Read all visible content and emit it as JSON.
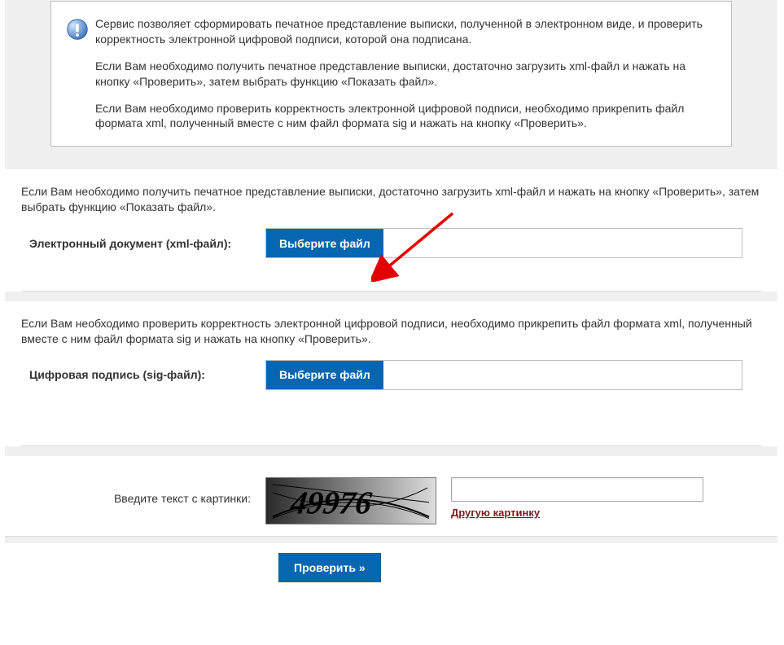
{
  "info": {
    "p1": "Сервис позволяет сформировать печатное представление выписки, полученной в электронном виде, и проверить корректность электронной цифровой подписи, которой она подписана.",
    "p2": "Если Вам необходимо получить печатное представление выписки, достаточно загрузить xml-файл и нажать на кнопку «Проверить», затем выбрать функцию «Показать файл».",
    "p3": "Если Вам необходимо проверить корректность электронной цифровой подписи, необходимо прикрепить файл формата xml, полученный вместе с ним файл формата sig и нажать на кнопку «Проверить»."
  },
  "xml_section": {
    "desc": "Если Вам необходимо получить печатное представление выписки, достаточно загрузить xml-файл и нажать на кнопку «Проверить», затем выбрать функцию «Показать файл».",
    "label": "Электронный документ (xml-файл):",
    "button": "Выберите файл",
    "value": ""
  },
  "sig_section": {
    "desc": "Если Вам необходимо проверить корректность электронной цифровой подписи, необходимо прикрепить файл формата xml, полученный вместе с ним файл формата sig и нажать на кнопку «Проверить».",
    "label": "Цифровая подпись (sig-файл):",
    "button": "Выберите файл",
    "value": ""
  },
  "captcha": {
    "label": "Введите текст с картинки:",
    "image_text": "49976",
    "refresh_link": "Другую картинку",
    "input_value": ""
  },
  "submit": {
    "label": "Проверить »"
  }
}
